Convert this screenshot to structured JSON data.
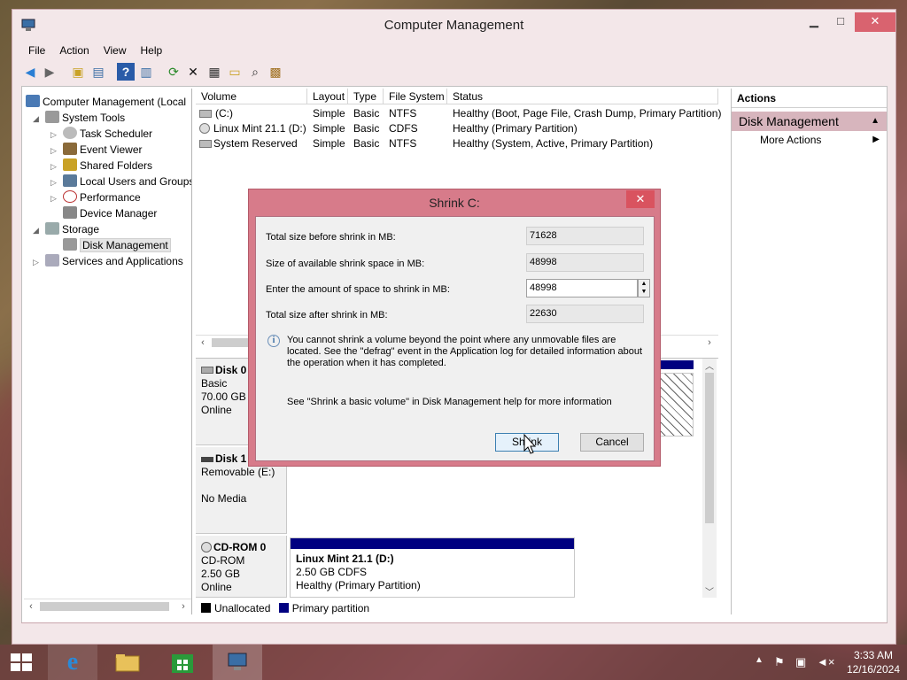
{
  "window": {
    "title": "Computer Management",
    "minimize": "▁",
    "maximize": "□",
    "close": "✕"
  },
  "menu": [
    "File",
    "Action",
    "View",
    "Help"
  ],
  "toolbar_icons": [
    "back-arrow-icon",
    "forward-arrow-icon",
    "up-folder-icon",
    "show-hide-tree-icon",
    "help-icon",
    "properties-pane-icon",
    "refresh-icon",
    "delete-icon",
    "properties-icon",
    "open-icon",
    "search-icon",
    "rescan-icon"
  ],
  "tree": {
    "root": "Computer Management (Local",
    "system_tools": "System Tools",
    "task_scheduler": "Task Scheduler",
    "event_viewer": "Event Viewer",
    "shared_folders": "Shared Folders",
    "local_users": "Local Users and Groups",
    "performance": "Performance",
    "device_manager": "Device Manager",
    "storage": "Storage",
    "disk_management": "Disk Management",
    "services": "Services and Applications"
  },
  "volumes": {
    "columns": [
      "Volume",
      "Layout",
      "Type",
      "File System",
      "Status"
    ],
    "rows": [
      {
        "volume": "(C:)",
        "layout": "Simple",
        "type": "Basic",
        "fs": "NTFS",
        "status": "Healthy (Boot, Page File, Crash Dump, Primary Partition)"
      },
      {
        "volume": "Linux Mint 21.1 (D:)",
        "layout": "Simple",
        "type": "Basic",
        "fs": "CDFS",
        "status": "Healthy (Primary Partition)"
      },
      {
        "volume": "System Reserved",
        "layout": "Simple",
        "type": "Basic",
        "fs": "NTFS",
        "status": "Healthy (System, Active, Primary Partition)"
      }
    ]
  },
  "disks": {
    "disk0": {
      "name": "Disk 0",
      "type": "Basic",
      "size": "70.00 GB",
      "state": "Online"
    },
    "disk1": {
      "name": "Disk 1",
      "type": "Removable (E:)",
      "state": "No Media"
    },
    "cdrom0": {
      "name": "CD-ROM 0",
      "type": "CD-ROM",
      "size": "2.50 GB",
      "state": "Online",
      "partition": {
        "name": "Linux Mint 21.1  (D:)",
        "size": "2.50 GB CDFS",
        "status": "Healthy (Primary Partition)"
      }
    }
  },
  "legend": {
    "unallocated": "Unallocated",
    "primary": "Primary partition"
  },
  "actions": {
    "header": "Actions",
    "section": "Disk Management",
    "more": "More Actions"
  },
  "dialog": {
    "title": "Shrink C:",
    "close": "✕",
    "total_before_label": "Total size before shrink in MB:",
    "total_before": "71628",
    "available_label": "Size of available shrink space in MB:",
    "available": "48998",
    "amount_label": "Enter the amount of space to shrink in MB:",
    "amount": "48998",
    "after_label": "Total size after shrink in MB:",
    "after": "22630",
    "info": "You cannot shrink a volume beyond the point where any unmovable files are located. See the \"defrag\" event in the Application log for detailed information about the operation when it has completed.",
    "help": "See \"Shrink a basic volume\" in Disk Management help for more information",
    "shrink_button": "Shrink",
    "cancel_button": "Cancel"
  },
  "taskbar": {
    "time": "3:33 AM",
    "date": "12/16/2024"
  },
  "colors": {
    "accent": "#d77b8a",
    "primary_partition": "#000080",
    "unallocated": "#000000",
    "selection": "#d7b5bd"
  }
}
